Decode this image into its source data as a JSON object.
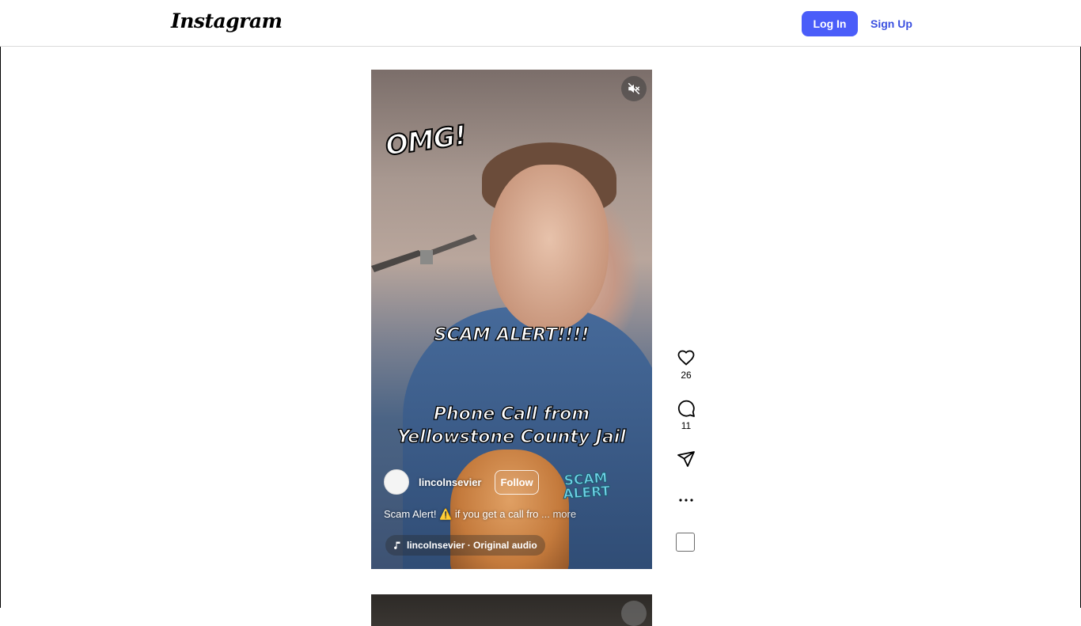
{
  "header": {
    "logo_text": "Instagram",
    "login_label": "Log In",
    "signup_label": "Sign Up",
    "accent_color": "#4a5df9"
  },
  "reel": {
    "overlay": {
      "omg": "OMG!",
      "scam_alert": "SCAM ALERT!!!!",
      "phone_line1": "Phone Call from",
      "phone_line2": "Yellowstone County Jail",
      "sticker_line1": "SCAM",
      "sticker_line2": "ALERT"
    },
    "author": {
      "username": "lincolnsevier",
      "follow_label": "Follow"
    },
    "caption": {
      "text": "Scam Alert! ⚠️ if you get a call fro",
      "more_label": "... more"
    },
    "audio": {
      "label": "lincolnsevier · Original audio"
    },
    "icons": {
      "mute": "speaker-muted-icon",
      "music": "music-note-icon"
    }
  },
  "actions": {
    "likes": "26",
    "comments": "11",
    "icons": [
      "heart-icon",
      "comment-icon",
      "share-icon",
      "more-icon"
    ]
  }
}
